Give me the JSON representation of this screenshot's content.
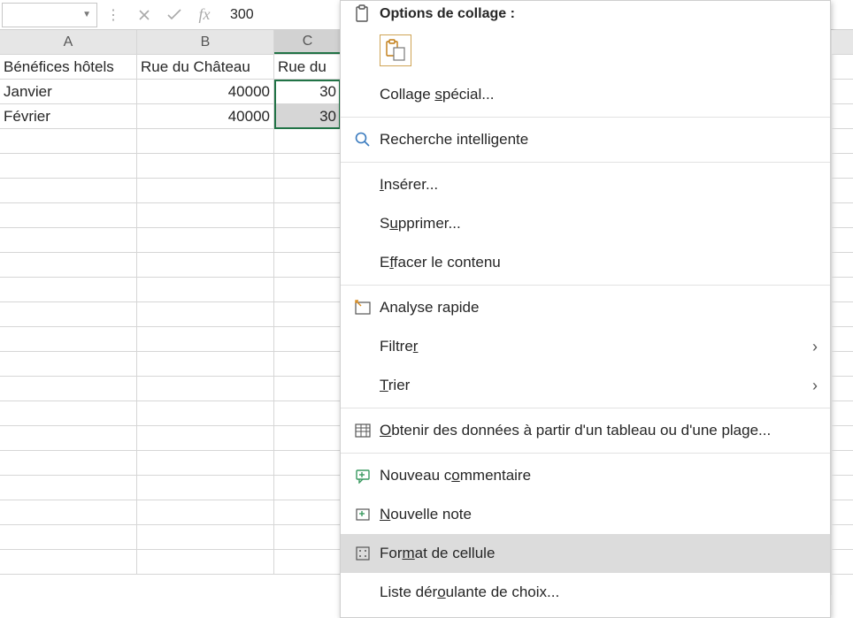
{
  "formula_bar": {
    "value": "300"
  },
  "columns": [
    "A",
    "B",
    "C"
  ],
  "sheet": {
    "headers": {
      "A": "Bénéfices hôtels",
      "B": "Rue du Château",
      "C_full": "Rue du"
    },
    "rows": [
      {
        "A": "Janvier",
        "B": "40000",
        "C": "30"
      },
      {
        "A": "Février",
        "B": "40000",
        "C": "30"
      }
    ]
  },
  "menu": {
    "header": "Options de collage :",
    "collage_special": "Collage spécial...",
    "recherche": "Recherche intelligente",
    "inserer": "Insérer...",
    "supprimer": "Supprimer...",
    "effacer": "Effacer le contenu",
    "analyse": "Analyse rapide",
    "filtrer_pre": "Filtre",
    "filtrer_u": "r",
    "trier_u": "T",
    "trier_post": "rier",
    "obtenir": "Obtenir des données à partir d'un tableau ou d'une plage...",
    "commentaire": "Nouveau commentaire",
    "note": "Nouvelle note",
    "format": "Format de cellule",
    "liste": "Liste déroulante de choix..."
  }
}
